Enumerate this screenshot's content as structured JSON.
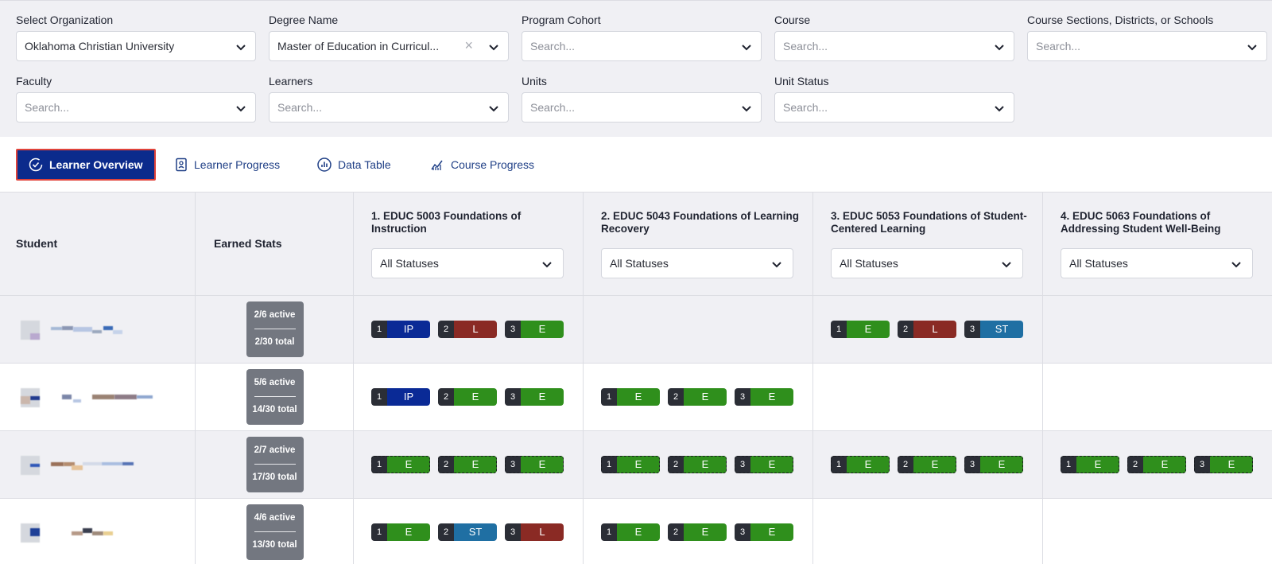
{
  "filters": [
    {
      "label": "Select Organization",
      "value": "Oklahoma Christian University",
      "placeholder": "",
      "clearable": false
    },
    {
      "label": "Degree Name",
      "value": "Master of Education in Curricul...",
      "placeholder": "",
      "clearable": true
    },
    {
      "label": "Program Cohort",
      "value": "",
      "placeholder": "Search...",
      "clearable": false
    },
    {
      "label": "Course",
      "value": "",
      "placeholder": "Search...",
      "clearable": false
    },
    {
      "label": "Course Sections, Districts, or Schools",
      "value": "",
      "placeholder": "Search...",
      "clearable": false
    },
    {
      "label": "Faculty",
      "value": "",
      "placeholder": "Search...",
      "clearable": false
    },
    {
      "label": "Learners",
      "value": "",
      "placeholder": "Search...",
      "clearable": false
    },
    {
      "label": "Units",
      "value": "",
      "placeholder": "Search...",
      "clearable": false
    },
    {
      "label": "Unit Status",
      "value": "",
      "placeholder": "Search...",
      "clearable": false
    }
  ],
  "tabs": [
    {
      "label": "Learner Overview",
      "icon": "check-circle-icon",
      "active": true
    },
    {
      "label": "Learner Progress",
      "icon": "clipboard-icon",
      "active": false
    },
    {
      "label": "Data Table",
      "icon": "bar-chart-icon",
      "active": false
    },
    {
      "label": "Course Progress",
      "icon": "line-chart-icon",
      "active": false
    }
  ],
  "table": {
    "student_header": "Student",
    "stats_header": "Earned Stats",
    "courses": [
      {
        "title": "1. EDUC 5003 Foundations of Instruction",
        "filter": "All Statuses"
      },
      {
        "title": "2. EDUC 5043 Foundations of Learning Recovery",
        "filter": "All Statuses"
      },
      {
        "title": "3. EDUC 5053 Foundations of Student-Centered Learning",
        "filter": "All Statuses"
      },
      {
        "title": "4. EDUC 5063 Foundations of Addressing Student Well-Being",
        "filter": "All Statuses"
      }
    ],
    "rows": [
      {
        "active": "2/6 active",
        "total": "2/30 total",
        "courses": [
          [
            {
              "n": "1",
              "s": "IP"
            },
            {
              "n": "2",
              "s": "L"
            },
            {
              "n": "3",
              "s": "E"
            }
          ],
          [],
          [
            {
              "n": "1",
              "s": "E"
            },
            {
              "n": "2",
              "s": "L"
            },
            {
              "n": "3",
              "s": "ST"
            }
          ],
          []
        ],
        "dashed": false
      },
      {
        "active": "5/6 active",
        "total": "14/30 total",
        "courses": [
          [
            {
              "n": "1",
              "s": "IP"
            },
            {
              "n": "2",
              "s": "E"
            },
            {
              "n": "3",
              "s": "E"
            }
          ],
          [
            {
              "n": "1",
              "s": "E"
            },
            {
              "n": "2",
              "s": "E"
            },
            {
              "n": "3",
              "s": "E"
            }
          ],
          [],
          []
        ],
        "dashed": false
      },
      {
        "active": "2/7 active",
        "total": "17/30 total",
        "courses": [
          [
            {
              "n": "1",
              "s": "E"
            },
            {
              "n": "2",
              "s": "E"
            },
            {
              "n": "3",
              "s": "E"
            }
          ],
          [
            {
              "n": "1",
              "s": "E"
            },
            {
              "n": "2",
              "s": "E"
            },
            {
              "n": "3",
              "s": "E"
            }
          ],
          [
            {
              "n": "1",
              "s": "E"
            },
            {
              "n": "2",
              "s": "E"
            },
            {
              "n": "3",
              "s": "E"
            }
          ],
          [
            {
              "n": "1",
              "s": "E"
            },
            {
              "n": "2",
              "s": "E"
            },
            {
              "n": "3",
              "s": "E"
            }
          ]
        ],
        "dashed": true
      },
      {
        "active": "4/6 active",
        "total": "13/30 total",
        "courses": [
          [
            {
              "n": "1",
              "s": "E"
            },
            {
              "n": "2",
              "s": "ST"
            },
            {
              "n": "3",
              "s": "L"
            }
          ],
          [
            {
              "n": "1",
              "s": "E"
            },
            {
              "n": "2",
              "s": "E"
            },
            {
              "n": "3",
              "s": "E"
            }
          ],
          [],
          []
        ],
        "dashed": false
      }
    ]
  },
  "colors": {
    "IP": "#0a2a96",
    "L": "#8a2a24",
    "E": "#2f8f1c",
    "ST": "#1f6fa3",
    "accent": "#0b2b8c"
  }
}
